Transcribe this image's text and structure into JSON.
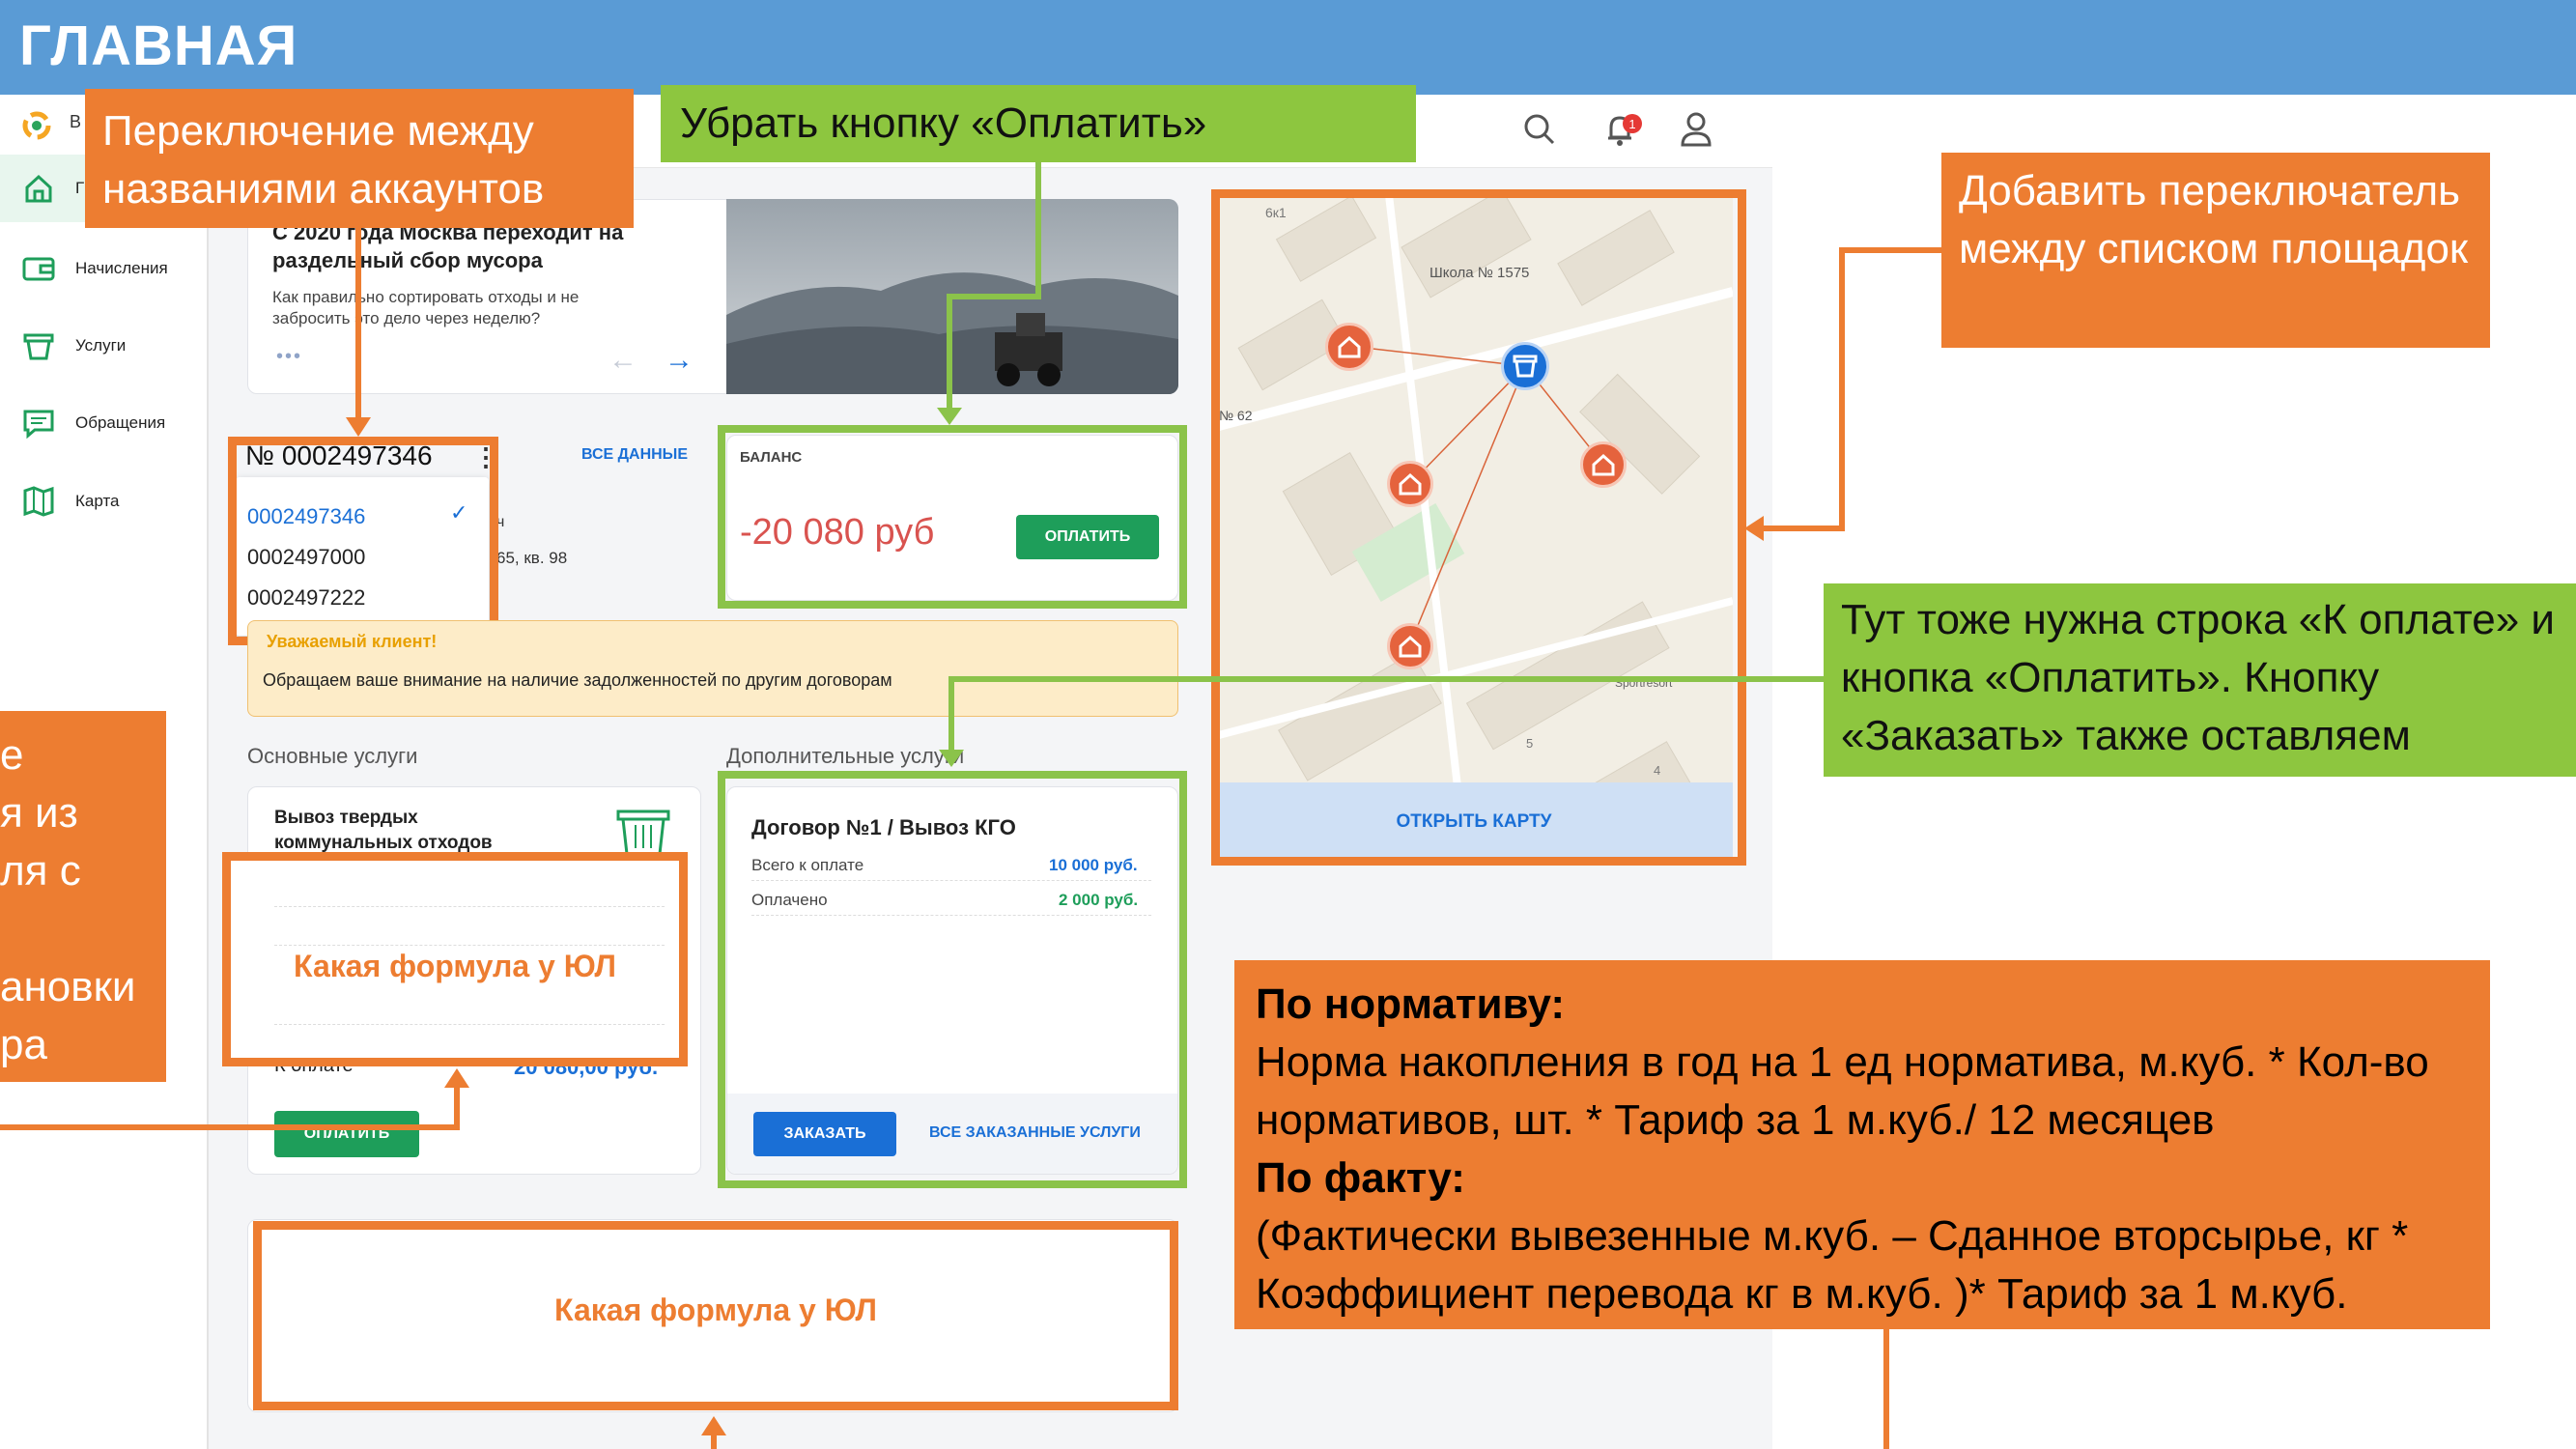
{
  "slide": {
    "title": "ГЛАВНАЯ"
  },
  "app": {
    "logo_text": "В",
    "sidebar": [
      {
        "label": "Г",
        "icon": "home-icon"
      },
      {
        "label": "Начисления",
        "icon": "wallet-icon"
      },
      {
        "label": "Услуги",
        "icon": "cart-icon"
      },
      {
        "label": "Обращения",
        "icon": "chat-icon"
      },
      {
        "label": "Карта",
        "icon": "map-icon"
      }
    ],
    "topbar_icons": [
      "search-icon",
      "bell-icon",
      "user-icon"
    ],
    "bell_badge": "1",
    "promo": {
      "title": "С 2020 года Москва переходит на раздельный сбор мусора",
      "subtitle": "Как правильно сортировать отходы и не забросить это дело через неделю?",
      "dots": "•••"
    },
    "account": {
      "number": "№ 0002497346",
      "all_data": "ВСЕ ДАННЫЕ",
      "menu": [
        "0002497346",
        "0002497000",
        "0002497222"
      ],
      "name_tail": "ч",
      "address_tail": "65, кв. 98"
    },
    "balance": {
      "label": "БАЛАНС",
      "value": "-20 080 руб",
      "pay": "ОПЛАТИТЬ"
    },
    "warning": {
      "title": "Уважаемый клиент!",
      "text": "Обращаем ваше внимание на наличие задолженностей по другим договорам"
    },
    "main_services": {
      "heading": "Основные услуги",
      "title": "Вывоз твердых коммунальных отходов",
      "to_pay_label": "К оплате",
      "to_pay_value": "20 080,00 руб.",
      "pay": "ОПЛАТИТЬ",
      "formula_note": "Какая формула у ЮЛ"
    },
    "extra_services": {
      "heading": "Дополнительные услуги",
      "contract": "Договор №1 / Вывоз КГО",
      "rows": [
        {
          "label": "Всего к оплате",
          "value": "10 000 руб."
        },
        {
          "label": "Оплачено",
          "value": "2 000 руб."
        }
      ],
      "order": "ЗАКАЗАТЬ",
      "all_orders": "ВСЕ ЗАКАЗАННЫЕ УСЛУГИ"
    },
    "bottom_formula_note": "Какая формула у ЮЛ",
    "map": {
      "labels": [
        "6к1",
        "Школа № 1575",
        "№ 62",
        "Sportresort",
        "5",
        "4"
      ],
      "open": "ОТКРЫТЬ КАРТУ"
    }
  },
  "annotations": {
    "accounts": "Переключение между названиями аккаунтов",
    "remove_pay": "Убрать кнопку «Оплатить»",
    "platforms": "Добавить переключатель между списком площадок",
    "extra_row": "Тут тоже нужна строка «К оплате» и кнопка «Оплатить». Кнопку «Заказать» также оставляем",
    "left_partial": [
      "е",
      "я из",
      "ля с",
      "",
      "ановки",
      "ра"
    ],
    "formula_title1": "По нормативу:",
    "formula_text1": "Норма накопления в год на 1 ед норматива, м.куб. * Кол-во нормативов, шт. * Тариф за 1 м.куб./ 12 месяцев",
    "formula_title2": "По факту:",
    "formula_text2": "(Фактически вывезенные м.куб. – Сданное вторсырье, кг * Коэффициент перевода кг в м.куб. )* Тариф за 1 м.куб."
  },
  "colors": {
    "header": "#5a9bd5",
    "orange": "#ed7d31",
    "green": "#8bc34a",
    "accent_green": "#1e9e5a",
    "accent_blue": "#1a6fd6",
    "negative": "#d9534f"
  }
}
